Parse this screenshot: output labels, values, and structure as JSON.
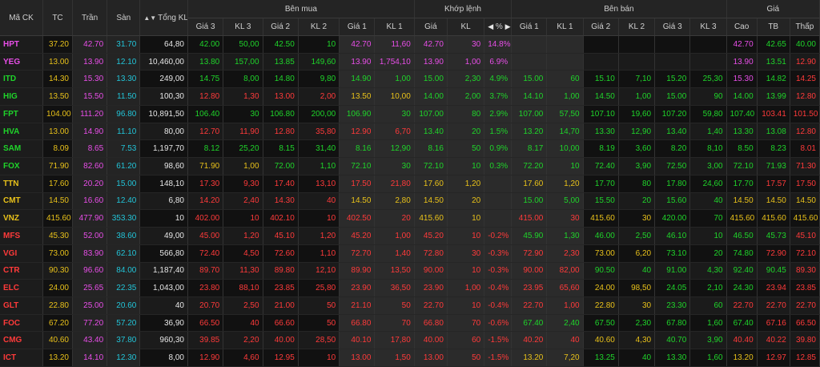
{
  "colors": {
    "up": "#1fd42a",
    "down": "#ff3a3a",
    "ref": "#e8c11a",
    "ceiling": "#e84ee8",
    "floor": "#22c4d8",
    "white": "#e6e6e6"
  },
  "header": {
    "ma_ck": "Mã CK",
    "tc": "TC",
    "tran": "Trần",
    "san": "Sàn",
    "tong_kl": "Tổng KL",
    "ben_mua": "Bên mua",
    "khop_lenh": "Khớp lệnh",
    "ben_ban": "Bên bán",
    "gia": "Giá",
    "buy_cols": [
      "Giá 3",
      "KL 3",
      "Giá 2",
      "KL 2",
      "Giá 1",
      "KL 1"
    ],
    "match_cols": [
      "Giá",
      "KL"
    ],
    "match_pct": "%",
    "sell_cols": [
      "Giá 1",
      "KL 1",
      "Giá 2",
      "KL 2",
      "Giá 3",
      "KL 3"
    ],
    "price_cols": [
      "Cao",
      "TB",
      "Thấp"
    ],
    "sort_icon": "sort-icon",
    "pct_sort_icons": [
      "chevron-left-icon",
      "chevron-right-icon"
    ]
  },
  "rows": [
    [
      "HPT",
      "37.20",
      "42.70",
      "31.70",
      "64,80",
      "42.00",
      "50,00",
      "42.50",
      "10",
      "42.70",
      "11,60",
      "42.70",
      "30",
      "14.8%",
      "",
      "",
      "",
      "",
      "",
      "",
      "42.70",
      "42.65",
      "40.00"
    ],
    [
      "YEG",
      "13.00",
      "13.90",
      "12.10",
      "10,460,00",
      "13.80",
      "157,00",
      "13.85",
      "149,60",
      "13.90",
      "1,754,10",
      "13.90",
      "1,00",
      "6.9%",
      "",
      "",
      "",
      "",
      "",
      "",
      "13.90",
      "13.51",
      "12.90"
    ],
    [
      "ITD",
      "14.30",
      "15.30",
      "13.30",
      "249,00",
      "14.75",
      "8,00",
      "14.80",
      "9,80",
      "14.90",
      "1,00",
      "15.00",
      "2,30",
      "4.9%",
      "15.00",
      "60",
      "15.10",
      "7,10",
      "15.20",
      "25,30",
      "15.30",
      "14.82",
      "14.25"
    ],
    [
      "HIG",
      "13.50",
      "15.50",
      "11.50",
      "100,30",
      "12.80",
      "1,30",
      "13.00",
      "2,00",
      "13.50",
      "10,00",
      "14.00",
      "2,00",
      "3.7%",
      "14.10",
      "1,00",
      "14.50",
      "1,00",
      "15.00",
      "90",
      "14.00",
      "13.99",
      "12.80"
    ],
    [
      "FPT",
      "104.00",
      "111.20",
      "96.80",
      "10,891,50",
      "106.40",
      "30",
      "106.80",
      "200,00",
      "106.90",
      "30",
      "107.00",
      "80",
      "2.9%",
      "107.00",
      "57,50",
      "107.10",
      "19,60",
      "107.20",
      "59,80",
      "107.40",
      "103.41",
      "101.50"
    ],
    [
      "HVA",
      "13.00",
      "14.90",
      "11.10",
      "80,00",
      "12.70",
      "11,90",
      "12.80",
      "35,80",
      "12.90",
      "6,70",
      "13.40",
      "20",
      "1.5%",
      "13.20",
      "14,70",
      "13.30",
      "12,90",
      "13.40",
      "1,40",
      "13.30",
      "13.08",
      "12.80"
    ],
    [
      "SAM",
      "8.09",
      "8.65",
      "7.53",
      "1,197,70",
      "8.12",
      "25,20",
      "8.15",
      "31,40",
      "8.16",
      "12,90",
      "8.16",
      "50",
      "0.9%",
      "8.17",
      "10,00",
      "8.19",
      "3,60",
      "8.20",
      "8,10",
      "8.50",
      "8.23",
      "8.01"
    ],
    [
      "FOX",
      "71.90",
      "82.60",
      "61.20",
      "98,60",
      "71.90",
      "1,00",
      "72.00",
      "1,10",
      "72.10",
      "30",
      "72.10",
      "10",
      "0.3%",
      "72.20",
      "10",
      "72.40",
      "3,90",
      "72.50",
      "3,00",
      "72.10",
      "71.93",
      "71.30"
    ],
    [
      "TTN",
      "17.60",
      "20.20",
      "15.00",
      "148,10",
      "17.30",
      "9,30",
      "17.40",
      "13,10",
      "17.50",
      "21,80",
      "17.60",
      "1,20",
      "",
      "17.60",
      "1,20",
      "17.70",
      "80",
      "17.80",
      "24,60",
      "17.70",
      "17.57",
      "17.50"
    ],
    [
      "CMT",
      "14.50",
      "16.60",
      "12.40",
      "6,80",
      "14.20",
      "2,40",
      "14.30",
      "40",
      "14.50",
      "2,80",
      "14.50",
      "20",
      "",
      "15.00",
      "5,00",
      "15.50",
      "20",
      "15.60",
      "40",
      "14.50",
      "14.50",
      "14.50"
    ],
    [
      "VNZ",
      "415.60",
      "477.90",
      "353.30",
      "10",
      "402.00",
      "10",
      "402.10",
      "10",
      "402.50",
      "20",
      "415.60",
      "10",
      "",
      "415.00",
      "30",
      "415.60",
      "30",
      "420.00",
      "70",
      "415.60",
      "415.60",
      "415.60"
    ],
    [
      "MFS",
      "45.30",
      "52.00",
      "38.60",
      "49,00",
      "45.00",
      "1,20",
      "45.10",
      "1,20",
      "45.20",
      "1,00",
      "45.20",
      "10",
      "-0.2%",
      "45.90",
      "1,30",
      "46.00",
      "2,50",
      "46.10",
      "10",
      "46.50",
      "45.73",
      "45.10"
    ],
    [
      "VGI",
      "73.00",
      "83.90",
      "62.10",
      "566,80",
      "72.40",
      "4,50",
      "72.60",
      "1,10",
      "72.70",
      "1,40",
      "72.80",
      "30",
      "-0.3%",
      "72.90",
      "2,30",
      "73.00",
      "6,20",
      "73.10",
      "20",
      "74.80",
      "72.90",
      "72.10"
    ],
    [
      "CTR",
      "90.30",
      "96.60",
      "84.00",
      "1,187,40",
      "89.70",
      "11,30",
      "89.80",
      "12,10",
      "89.90",
      "13,50",
      "90.00",
      "10",
      "-0.3%",
      "90.00",
      "82,00",
      "90.50",
      "40",
      "91.00",
      "4,30",
      "92.40",
      "90.45",
      "89.30"
    ],
    [
      "ELC",
      "24.00",
      "25.65",
      "22.35",
      "1,043,00",
      "23.80",
      "88,10",
      "23.85",
      "25,80",
      "23.90",
      "36,50",
      "23.90",
      "1,00",
      "-0.4%",
      "23.95",
      "65,60",
      "24.00",
      "98,50",
      "24.05",
      "2,10",
      "24.30",
      "23.94",
      "23.85"
    ],
    [
      "GLT",
      "22.80",
      "25.00",
      "20.60",
      "40",
      "20.70",
      "2,50",
      "21.00",
      "50",
      "21.10",
      "50",
      "22.70",
      "10",
      "-0.4%",
      "22.70",
      "1,00",
      "22.80",
      "30",
      "23.30",
      "60",
      "22.70",
      "22.70",
      "22.70"
    ],
    [
      "FOC",
      "67.20",
      "77.20",
      "57.20",
      "36,90",
      "66.50",
      "40",
      "66.60",
      "50",
      "66.80",
      "70",
      "66.80",
      "70",
      "-0.6%",
      "67.40",
      "2,40",
      "67.50",
      "2,30",
      "67.80",
      "1,60",
      "67.40",
      "67.16",
      "66.50"
    ],
    [
      "CMG",
      "40.60",
      "43.40",
      "37.80",
      "960,30",
      "39.85",
      "2,20",
      "40.00",
      "28,50",
      "40.10",
      "17,80",
      "40.00",
      "60",
      "-1.5%",
      "40.20",
      "40",
      "40.60",
      "4,30",
      "40.70",
      "3,90",
      "40.40",
      "40.22",
      "39.80"
    ],
    [
      "ICT",
      "13.20",
      "14.10",
      "12.30",
      "8,00",
      "12.90",
      "4,60",
      "12.95",
      "10",
      "13.00",
      "1,50",
      "13.00",
      "50",
      "-1.5%",
      "13.20",
      "7,20",
      "13.25",
      "40",
      "13.30",
      "1,60",
      "13.20",
      "12.97",
      "12.85"
    ]
  ]
}
